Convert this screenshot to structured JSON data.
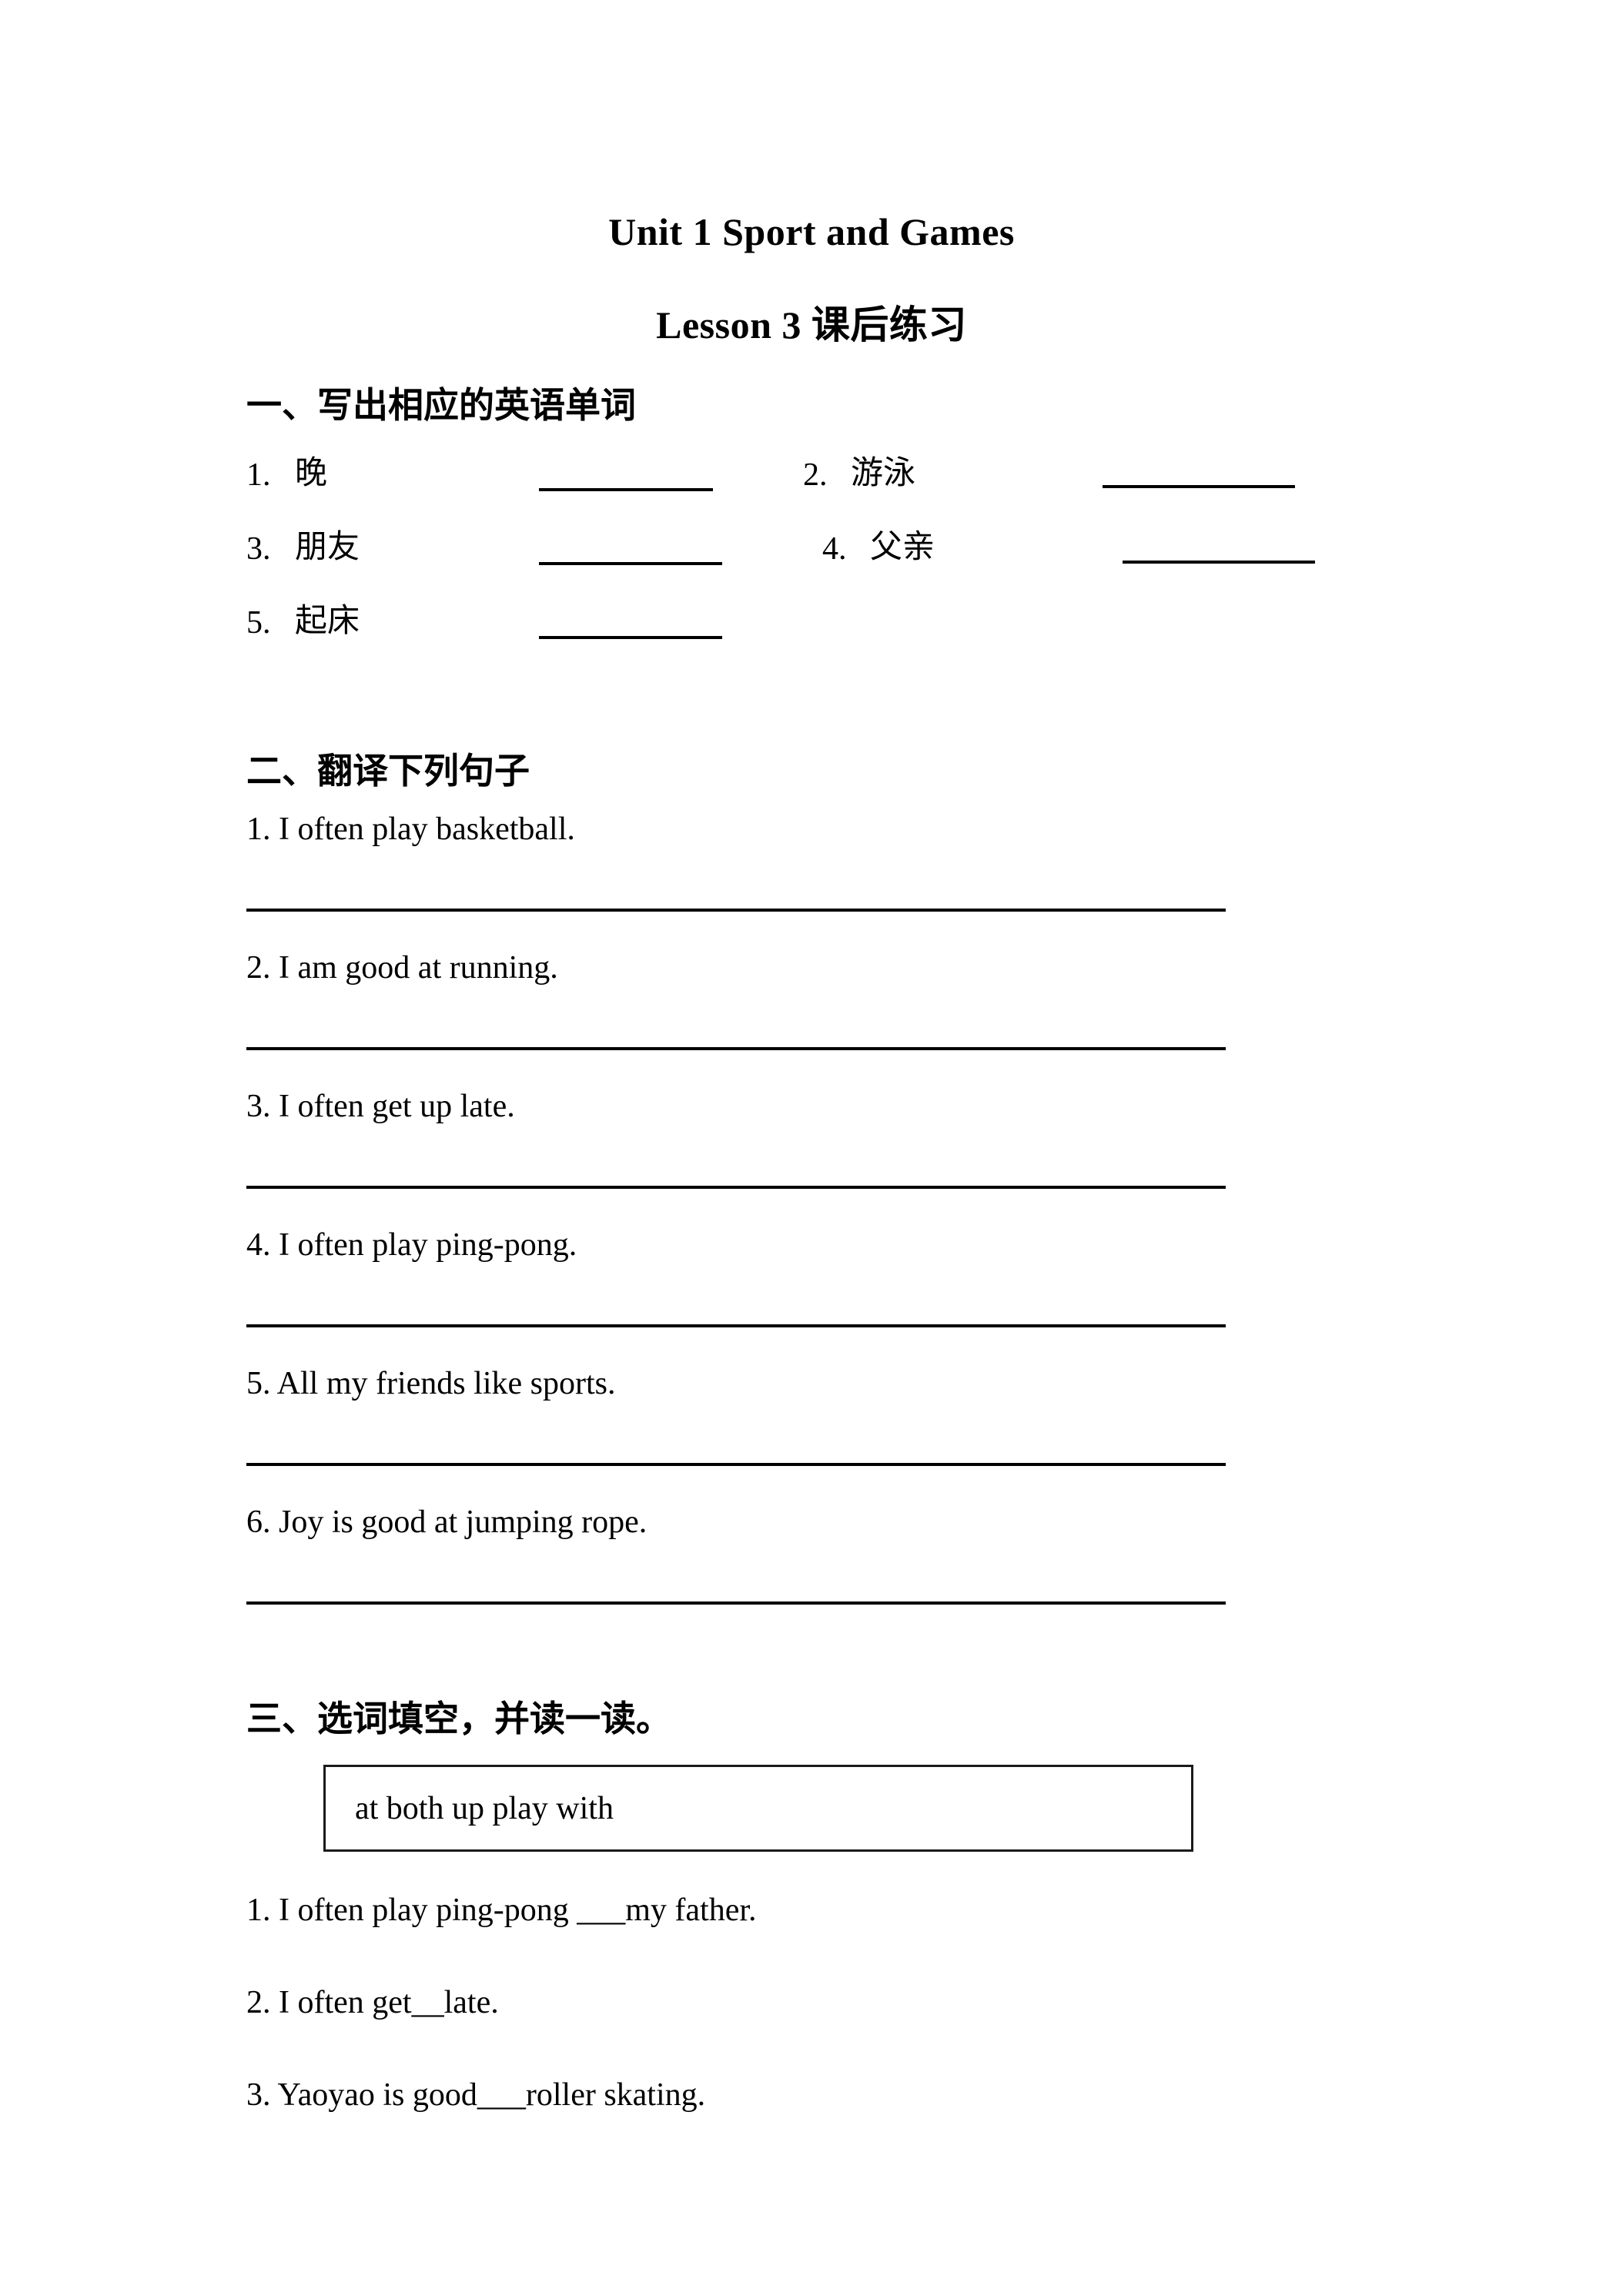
{
  "header": {
    "title": "Unit 1 Sport and Games",
    "subtitle": "Lesson 3  课后练习"
  },
  "section1": {
    "heading": "一、写出相应的英语单词",
    "items": [
      {
        "number": "1.",
        "word": "晚"
      },
      {
        "number": "2.",
        "word": "游泳"
      },
      {
        "number": "3.",
        "word": "朋友"
      },
      {
        "number": "4.",
        "word": "父亲"
      },
      {
        "number": "5.",
        "word": "起床"
      }
    ]
  },
  "section2": {
    "heading": "二、翻译下列句子",
    "sentences": [
      "1. I often play basketball.",
      "2. I am good at running.",
      "3. I often get up late.",
      "4. I often play ping-pong.",
      "5. All my friends like sports.",
      "6. Joy is good at jumping rope."
    ]
  },
  "section3": {
    "heading": "三、选词填空，并读一读。",
    "word_bank": "at both up play with",
    "questions": [
      "1.  I often play ping-pong ___my father.",
      "2. I often get__late.",
      "3. Yaoyao is good___roller skating."
    ]
  }
}
